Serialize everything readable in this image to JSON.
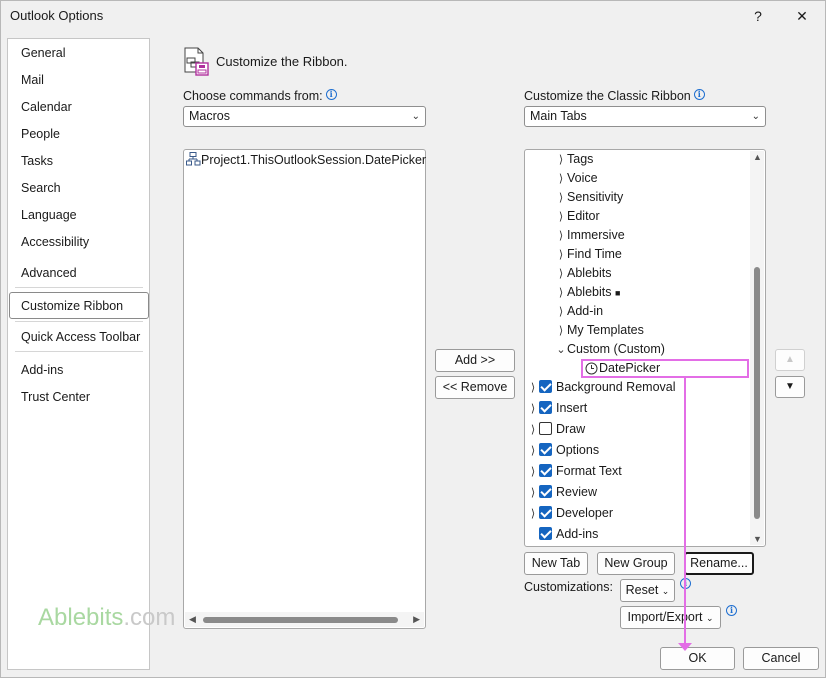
{
  "window": {
    "title": "Outlook Options",
    "help_glyph": "?",
    "close_glyph": "✕"
  },
  "nav": {
    "items": [
      {
        "label": "General"
      },
      {
        "label": "Mail"
      },
      {
        "label": "Calendar"
      },
      {
        "label": "People"
      },
      {
        "label": "Tasks"
      },
      {
        "label": "Search"
      },
      {
        "label": "Language"
      },
      {
        "label": "Accessibility"
      },
      {
        "label": "Advanced"
      },
      {
        "label": "Customize Ribbon",
        "selected": true
      },
      {
        "label": "Quick Access Toolbar"
      },
      {
        "label": "Add-ins"
      },
      {
        "label": "Trust Center"
      }
    ]
  },
  "header": {
    "title": "Customize the Ribbon."
  },
  "left": {
    "label": "Choose commands from:",
    "combo_value": "Macros",
    "items": [
      "Project1.ThisOutlookSession.DatePicker"
    ]
  },
  "right": {
    "label": "Customize the Classic Ribbon",
    "combo_value": "Main Tabs",
    "tree": [
      {
        "label": "Tags",
        "type": "group"
      },
      {
        "label": "Voice",
        "type": "group"
      },
      {
        "label": "Sensitivity",
        "type": "group"
      },
      {
        "label": "Editor",
        "type": "group"
      },
      {
        "label": "Immersive",
        "type": "group"
      },
      {
        "label": "Find Time",
        "type": "group"
      },
      {
        "label": "Ablebits",
        "type": "group"
      },
      {
        "label": "Ablebits",
        "type": "group",
        "marker": "■"
      },
      {
        "label": "Add-in",
        "type": "group"
      },
      {
        "label": "My Templates",
        "type": "group"
      },
      {
        "label": "Custom (Custom)",
        "type": "group-open"
      },
      {
        "label": "DatePicker",
        "type": "command",
        "highlighted": true
      },
      {
        "label": "Background Removal",
        "type": "tab",
        "checked": true
      },
      {
        "label": "Insert",
        "type": "tab",
        "checked": true
      },
      {
        "label": "Draw",
        "type": "tab",
        "checked": false
      },
      {
        "label": "Options",
        "type": "tab",
        "checked": true
      },
      {
        "label": "Format Text",
        "type": "tab",
        "checked": true
      },
      {
        "label": "Review",
        "type": "tab",
        "checked": true
      },
      {
        "label": "Developer",
        "type": "tab",
        "checked": true
      },
      {
        "label": "Add-ins",
        "type": "tab",
        "checked": true
      }
    ]
  },
  "middle": {
    "add_label": "Add >>",
    "remove_label": "<< Remove"
  },
  "bottom": {
    "new_tab": "New Tab",
    "new_group": "New Group",
    "rename": "Rename...",
    "customizations_label": "Customizations:",
    "reset": "Reset",
    "import_export": "Import/Export",
    "ok": "OK",
    "cancel": "Cancel"
  },
  "watermark": {
    "brand": "Ablebits",
    "suffix": ".com"
  },
  "colors": {
    "accent": "#1565c0",
    "highlight": "#e36ee6",
    "watermark": "#a9d8a1"
  }
}
